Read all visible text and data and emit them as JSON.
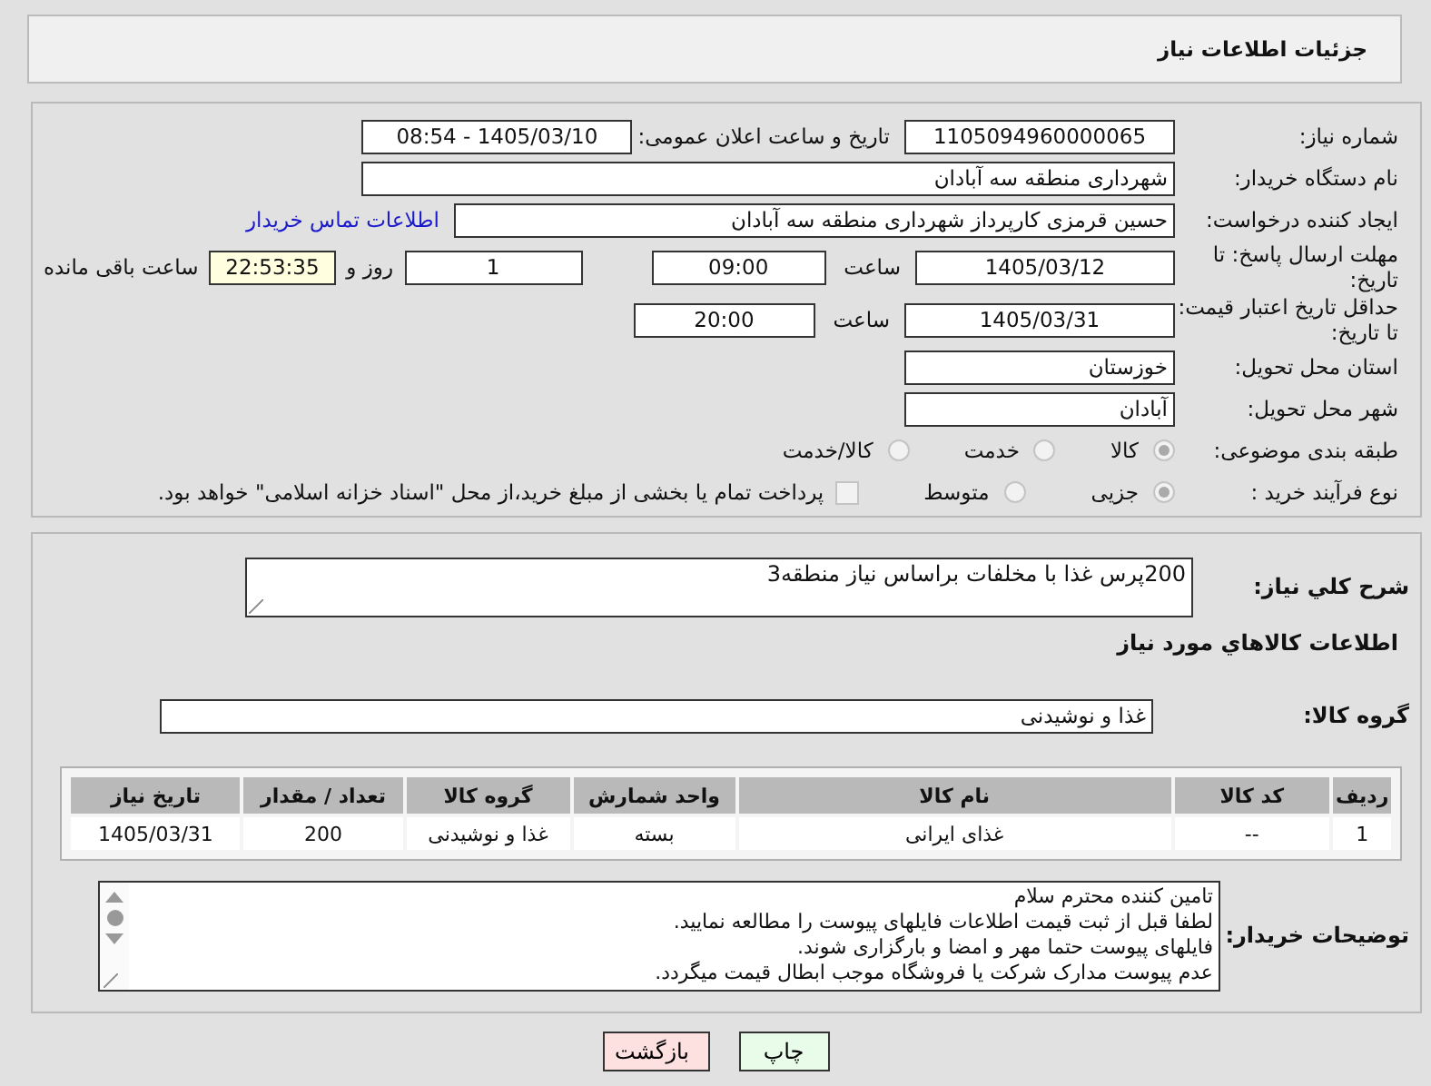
{
  "header": {
    "title": "جزئیات اطلاعات نیاز"
  },
  "need_number": {
    "label": "شماره نیاز:",
    "value": "1105094960000065"
  },
  "announce": {
    "label": "تاریخ و ساعت اعلان عمومی:",
    "value": "1405/03/10 - 08:54"
  },
  "buyer": {
    "label": "نام دستگاه خریدار:",
    "value": "شهرداری منطقه سه آبادان"
  },
  "creator": {
    "label": "ایجاد کننده درخواست:",
    "value": "حسین قرمزی کارپرداز شهرداری منطقه سه آبادان",
    "link": "اطلاعات تماس خریدار"
  },
  "deadline": {
    "label": "مهلت ارسال پاسخ: تا تاریخ:",
    "date": "1405/03/12",
    "time_label": "ساعت",
    "time": "09:00",
    "days": "1",
    "days_label": "روز و",
    "remaining": "22:53:35",
    "remaining_label": "ساعت باقی مانده"
  },
  "validity": {
    "label": "حداقل تاریخ اعتبار قیمت: تا تاریخ:",
    "date": "1405/03/31",
    "time_label": "ساعت",
    "time": "20:00"
  },
  "province": {
    "label": "استان محل تحویل:",
    "value": "خوزستان"
  },
  "city": {
    "label": "شهر محل تحویل:",
    "value": "آبادان"
  },
  "category": {
    "label": "طبقه بندی موضوعی:",
    "options": [
      {
        "label": "کالا",
        "selected": true
      },
      {
        "label": "خدمت",
        "selected": false
      },
      {
        "label": "کالا/خدمت",
        "selected": false
      }
    ]
  },
  "process": {
    "label": "نوع فرآیند خرید :",
    "options": [
      {
        "label": "جزیی",
        "selected": true
      },
      {
        "label": "متوسط",
        "selected": false
      }
    ],
    "treasury": {
      "label": "پرداخت تمام یا بخشی از مبلغ خرید،از محل \"اسناد خزانه اسلامی\" خواهد بود.",
      "checked": false
    }
  },
  "summary": {
    "label": "شرح کلي نياز:",
    "value": "200پرس غذا با مخلفات براساس نیاز منطقه3"
  },
  "goods_heading": "اطلاعات کالاهاي مورد نياز",
  "goods_group": {
    "label": "گروه کالا:",
    "value": "غذا و نوشیدنی"
  },
  "table": {
    "columns": [
      "ردیف",
      "کد کالا",
      "نام کالا",
      "واحد شمارش",
      "گروه کالا",
      "تعداد / مقدار",
      "تاریخ نیاز"
    ],
    "rows": [
      [
        "1",
        "--",
        "غذای ایرانی",
        "بسته",
        "غذا و نوشیدنی",
        "200",
        "1405/03/31"
      ]
    ]
  },
  "notes": {
    "label": "توضیحات خریدار:",
    "lines": [
      "تامین کننده محترم سلام",
      "لطفا قبل از ثبت قیمت اطلاعات فایلهای پیوست را مطالعه نمایید.",
      "فایلهای پیوست حتما مهر و امضا و بارگزاری شوند.",
      "عدم پیوست مدارک شرکت یا فروشگاه موجب ابطال قیمت میگردد."
    ]
  },
  "buttons": [
    {
      "label": "چاپ",
      "kind": "print"
    },
    {
      "label": "بازگشت",
      "kind": "back"
    }
  ]
}
